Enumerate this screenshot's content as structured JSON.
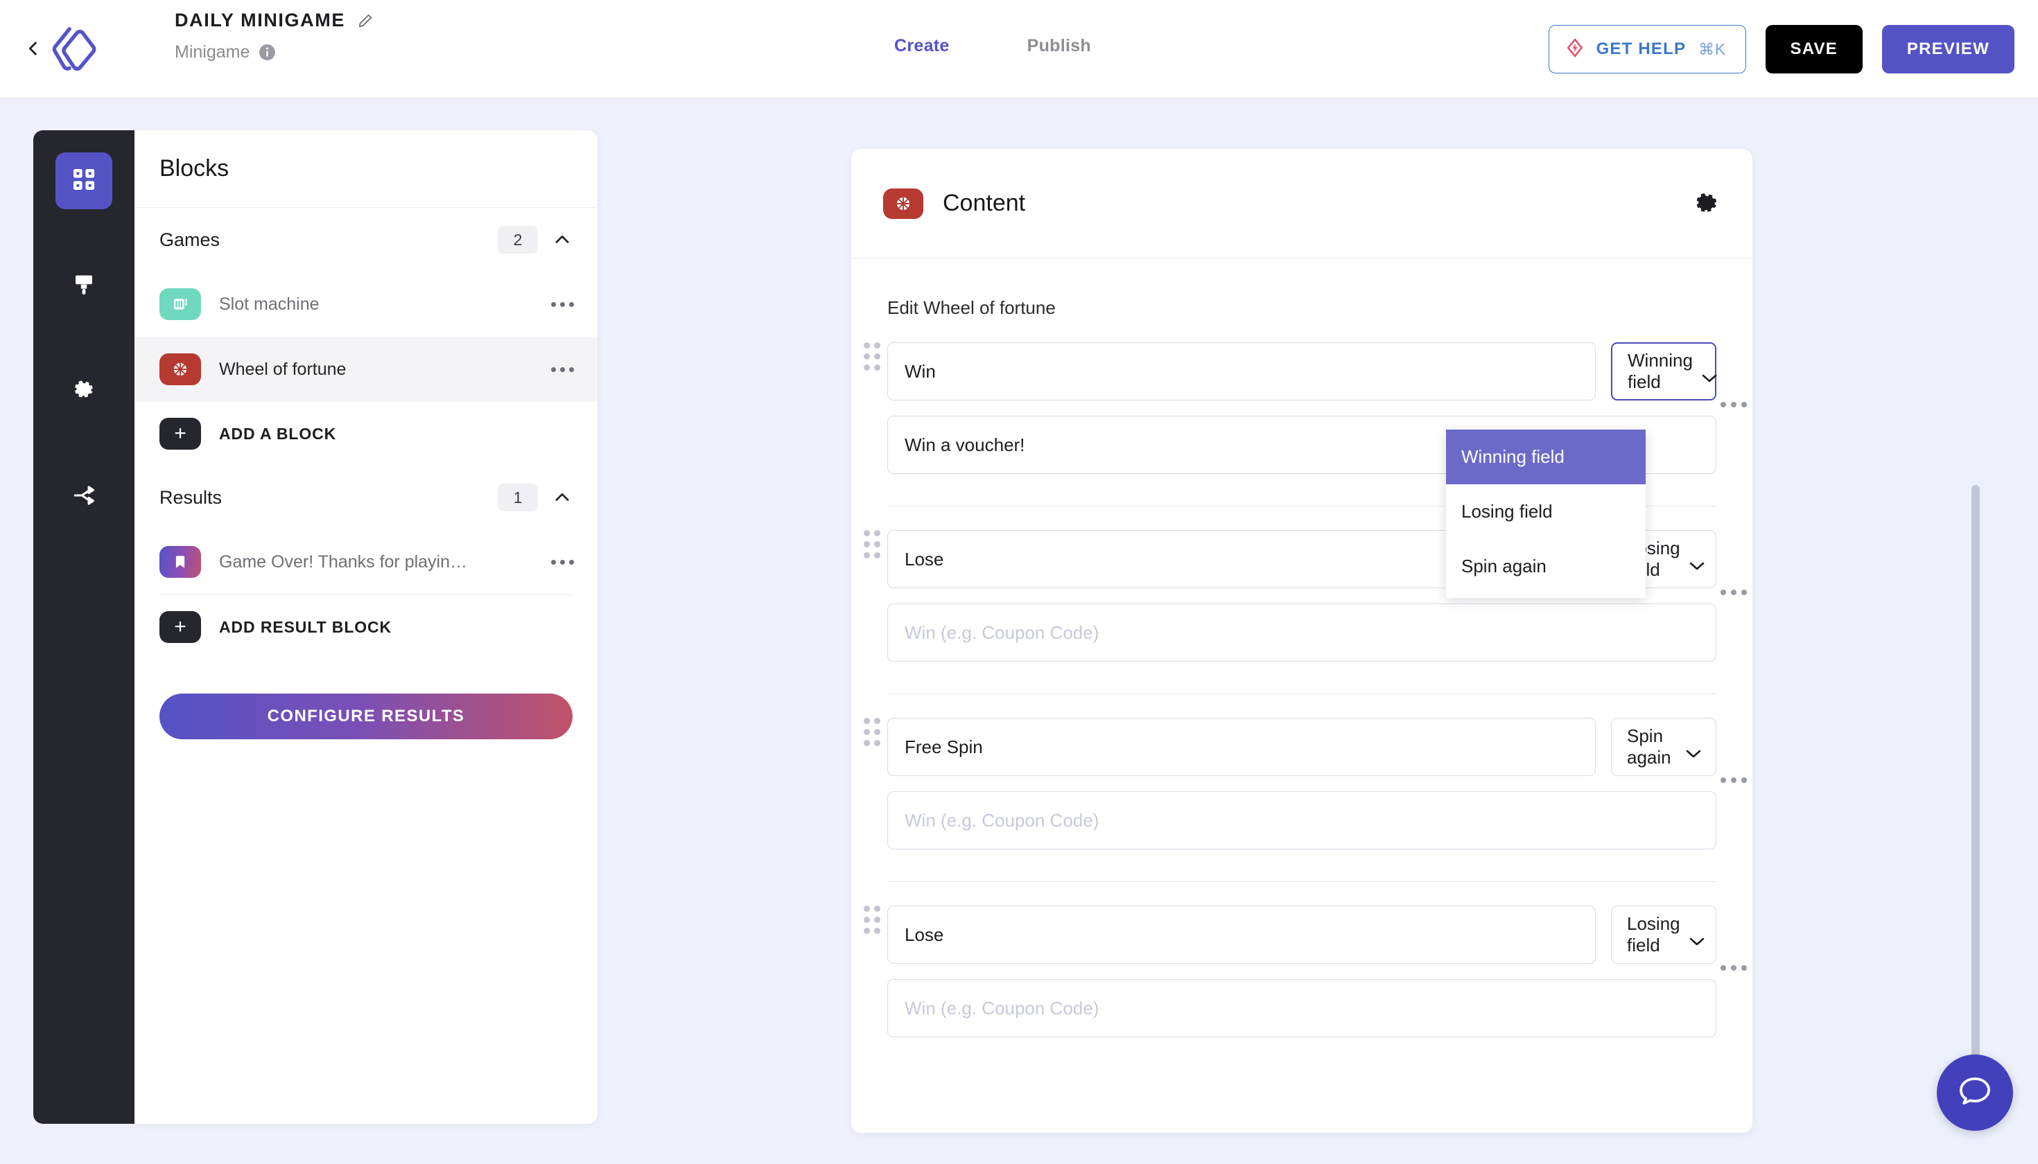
{
  "header": {
    "back_icon": "chevron-left-icon",
    "logo_icon": "brand-logo-icon",
    "title": "DAILY MINIGAME",
    "edit_icon": "pencil-icon",
    "subtitle": "Minigame",
    "info_icon": "info-icon",
    "tabs": [
      {
        "label": "Create",
        "active": true
      },
      {
        "label": "Publish",
        "active": false
      }
    ],
    "get_help_label": "GET HELP",
    "get_help_shortcut": "⌘K",
    "get_help_icon": "diamond-bolt-icon",
    "save_label": "SAVE",
    "preview_label": "PREVIEW",
    "accent_color": "#5453c6",
    "help_color": "#3a78c9"
  },
  "rail": {
    "items": [
      {
        "icon": "grid-blocks-icon",
        "active": true
      },
      {
        "icon": "paintbrush-icon",
        "active": false
      },
      {
        "icon": "gear-icon",
        "active": false
      },
      {
        "icon": "share-nodes-icon",
        "active": false
      }
    ]
  },
  "blocks_panel": {
    "title": "Blocks",
    "sections": [
      {
        "name": "Games",
        "count": "2",
        "chevron": "chevron-up-icon",
        "items": [
          {
            "label": "Slot machine",
            "icon": "slot-machine-icon",
            "icon_color": "#6fd9c0",
            "selected": false
          },
          {
            "label": "Wheel of fortune",
            "icon": "wheel-of-fortune-icon",
            "icon_color": "#b63a32",
            "selected": true
          }
        ],
        "add_label": "ADD A BLOCK"
      },
      {
        "name": "Results",
        "count": "1",
        "chevron": "chevron-up-icon",
        "items": [
          {
            "label": "Game Over! Thanks for playin…",
            "icon": "bookmark-icon",
            "icon_color": "gradient",
            "selected": false
          }
        ],
        "add_label": "ADD RESULT BLOCK"
      }
    ],
    "configure_label": "CONFIGURE RESULTS"
  },
  "content": {
    "badge_icon": "wheel-of-fortune-icon",
    "title": "Content",
    "gear_icon": "gear-icon",
    "edit_heading": "Edit Wheel of fortune",
    "coupon_placeholder": "Win (e.g. Coupon Code)",
    "row_menu_icon": "ellipsis-icon",
    "drag_handle_icon": "drag-handle-icon",
    "chevron_icon": "chevron-down-icon",
    "rows": [
      {
        "label": "Win",
        "type": "Winning field",
        "coupon": "Win a voucher!",
        "coupon_filled": true,
        "open": true
      },
      {
        "label": "Lose",
        "type": "Losing field",
        "coupon": "",
        "coupon_filled": false,
        "open": false
      },
      {
        "label": "Free Spin",
        "type": "Spin again",
        "coupon": "",
        "coupon_filled": false,
        "open": false
      },
      {
        "label": "Lose",
        "type": "Losing field",
        "coupon": "",
        "coupon_filled": false,
        "open": false
      }
    ],
    "dropdown": {
      "options": [
        {
          "label": "Winning field",
          "selected": true
        },
        {
          "label": "Losing field",
          "selected": false
        },
        {
          "label": "Spin again",
          "selected": false
        }
      ],
      "highlight_color": "#6c6ac9"
    }
  },
  "chat": {
    "icon": "chat-bubble-icon",
    "color": "#4340bc"
  },
  "scrollbar": {
    "name": "vertical-scrollbar"
  }
}
